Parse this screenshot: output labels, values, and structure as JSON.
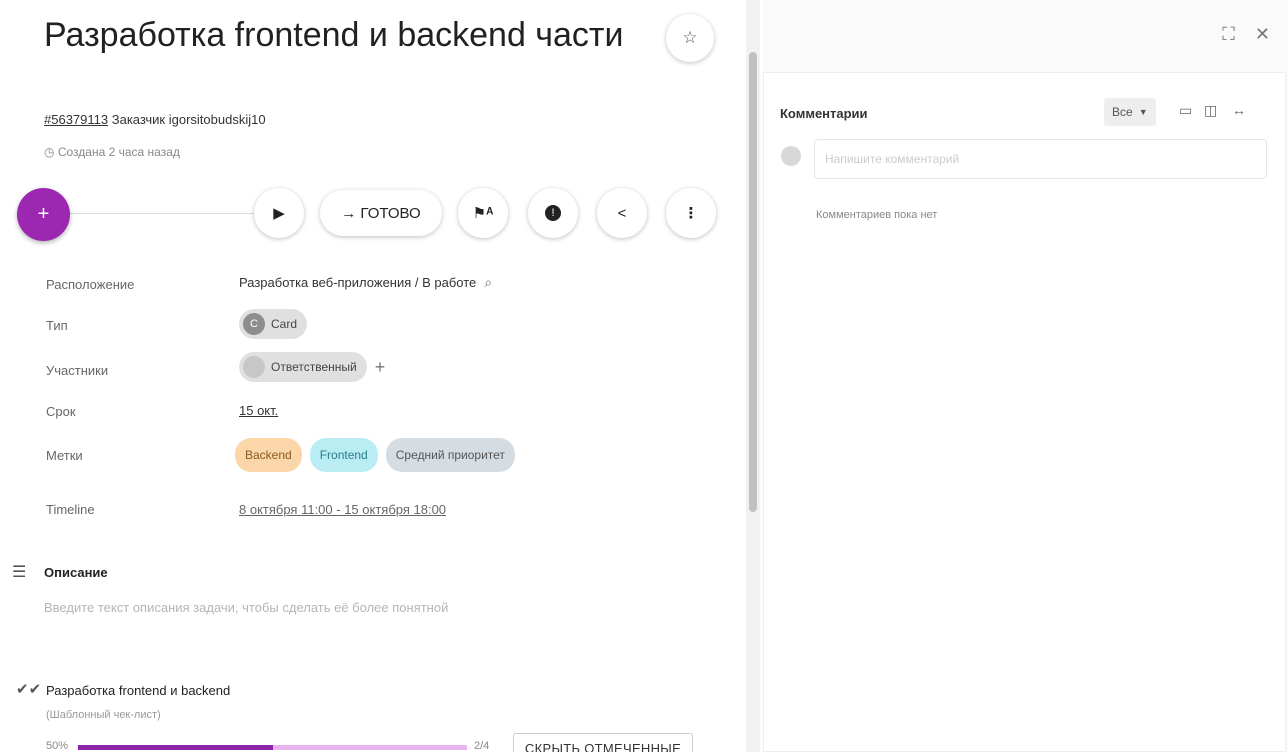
{
  "task": {
    "title": "Разработка frontend и backend части",
    "number": "#56379113",
    "customer_label": "Заказчик igorsitobudskij10",
    "created": "Создана 2 часа назад"
  },
  "toolbar": {
    "add_icon": "plus-icon",
    "play_icon": "play-icon",
    "done_label": "→ ГОТОВО",
    "flag_icon": "flag-icon",
    "info_icon": "info-icon",
    "share_icon": "share-icon",
    "more_icon": "more-vert-icon",
    "accent_color": "#9c27b0"
  },
  "fields": {
    "location": {
      "label": "Расположение",
      "value": "Разработка веб-приложения / В работе"
    },
    "type": {
      "label": "Тип",
      "avatar": "C",
      "value": "Card"
    },
    "participants": {
      "label": "Участники",
      "value": "Ответственный"
    },
    "due": {
      "label": "Срок",
      "value": "15 окт."
    },
    "tags": {
      "label": "Метки",
      "items": [
        {
          "name": "Backend",
          "color": "#fbd6a8"
        },
        {
          "name": "Frontend",
          "color": "#b9ecf3"
        },
        {
          "name": "Средний приоритет",
          "color": "#d6dde2"
        }
      ]
    },
    "timeline": {
      "label": "Timeline",
      "value": "8 октября 11:00 - 15 октября 18:00"
    }
  },
  "description": {
    "title": "Описание",
    "placeholder": "Введите текст описания задачи, чтобы сделать её более понятной"
  },
  "checklist": {
    "title": "Разработка frontend и backend",
    "subtitle": "(Шаблонный чек-лист)",
    "percent": "50%",
    "progress": 0.5,
    "count": "2/4",
    "hide_button": "СКРЫТЬ ОТМЕЧЕННЫЕ"
  },
  "comments": {
    "title": "Комментарии",
    "filter": "Все",
    "placeholder": "Напишите комментарий",
    "empty": "Комментариев пока нет"
  }
}
